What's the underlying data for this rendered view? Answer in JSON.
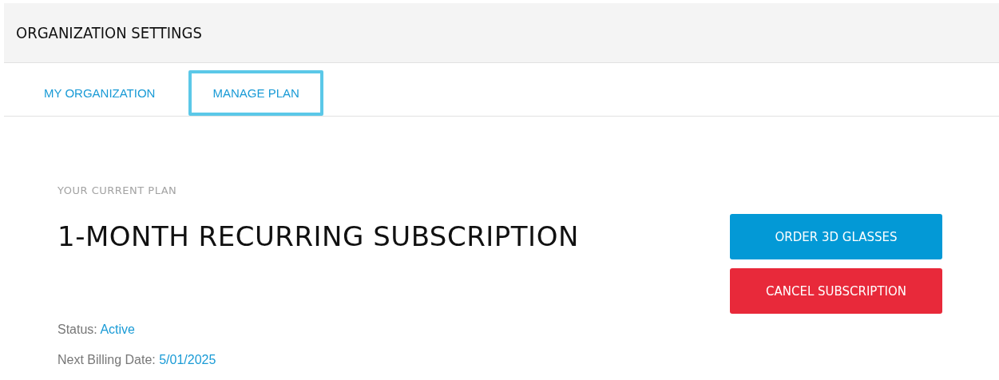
{
  "header": {
    "title": "ORGANIZATION SETTINGS"
  },
  "tabs": [
    {
      "label": "MY ORGANIZATION",
      "selected": false
    },
    {
      "label": "MANAGE PLAN",
      "selected": true
    }
  ],
  "plan": {
    "caption": "YOUR CURRENT PLAN",
    "name": "1-MONTH RECURRING SUBSCRIPTION",
    "details": [
      {
        "label": "Status:",
        "value": "Active"
      },
      {
        "label": "Next Billing Date:",
        "value": "5/01/2025"
      }
    ]
  },
  "buttons": [
    {
      "label": "ORDER 3D GLASSES",
      "kind": "primary"
    },
    {
      "label": "CANCEL SUBSCRIPTION",
      "kind": "danger"
    }
  ]
}
